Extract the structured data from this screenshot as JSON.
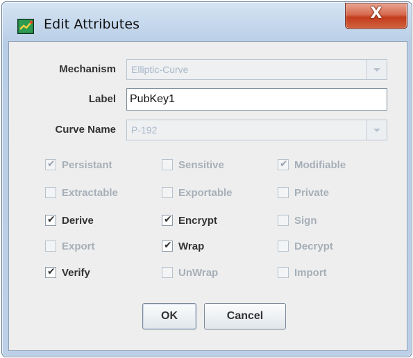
{
  "window": {
    "title": "Edit Attributes",
    "close_label": "X"
  },
  "form": {
    "mechanism": {
      "label": "Mechanism",
      "value": "Elliptic-Curve"
    },
    "key_label": {
      "label": "Label",
      "value": "PubKey1"
    },
    "curve_name": {
      "label": "Curve Name",
      "value": "P-192"
    }
  },
  "checkboxes": [
    {
      "label": "Persistant",
      "checked": true,
      "enabled": false
    },
    {
      "label": "Sensitive",
      "checked": false,
      "enabled": false
    },
    {
      "label": "Modifiable",
      "checked": true,
      "enabled": false
    },
    {
      "label": "Extractable",
      "checked": false,
      "enabled": false
    },
    {
      "label": "Exportable",
      "checked": false,
      "enabled": false
    },
    {
      "label": "Private",
      "checked": false,
      "enabled": false
    },
    {
      "label": "Derive",
      "checked": true,
      "enabled": true
    },
    {
      "label": "Encrypt",
      "checked": true,
      "enabled": true
    },
    {
      "label": "Sign",
      "checked": false,
      "enabled": false
    },
    {
      "label": "Export",
      "checked": false,
      "enabled": false
    },
    {
      "label": "Wrap",
      "checked": true,
      "enabled": true
    },
    {
      "label": "Decrypt",
      "checked": false,
      "enabled": false
    },
    {
      "label": "Verify",
      "checked": true,
      "enabled": true
    },
    {
      "label": "UnWrap",
      "checked": false,
      "enabled": false
    },
    {
      "label": "Import",
      "checked": false,
      "enabled": false
    }
  ],
  "buttons": {
    "ok": "OK",
    "cancel": "Cancel"
  }
}
